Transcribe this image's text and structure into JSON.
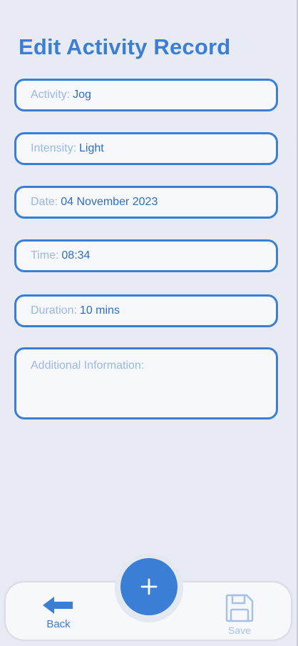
{
  "page": {
    "title": "Edit Activity Record"
  },
  "fields": {
    "activity": {
      "label": "Activity:",
      "value": "Jog"
    },
    "intensity": {
      "label": "Intensity:",
      "value": "Light"
    },
    "date": {
      "label": "Date:",
      "value": "04 November 2023"
    },
    "time": {
      "label": "Time:",
      "value": "08:34"
    },
    "duration": {
      "label": "Duration:",
      "value": "10 mins"
    },
    "notes": {
      "placeholder": "Additional Information:",
      "value": ""
    }
  },
  "bottom_nav": {
    "back_label": "Back",
    "add_icon": "plus-icon",
    "save_label": "Save",
    "save_enabled": false
  },
  "colors": {
    "accent": "#3a7fd5",
    "label_muted": "#9ab8e3",
    "background": "#e8ebf3",
    "field_background": "#f6f8fb",
    "disabled": "#a6c2ea"
  }
}
